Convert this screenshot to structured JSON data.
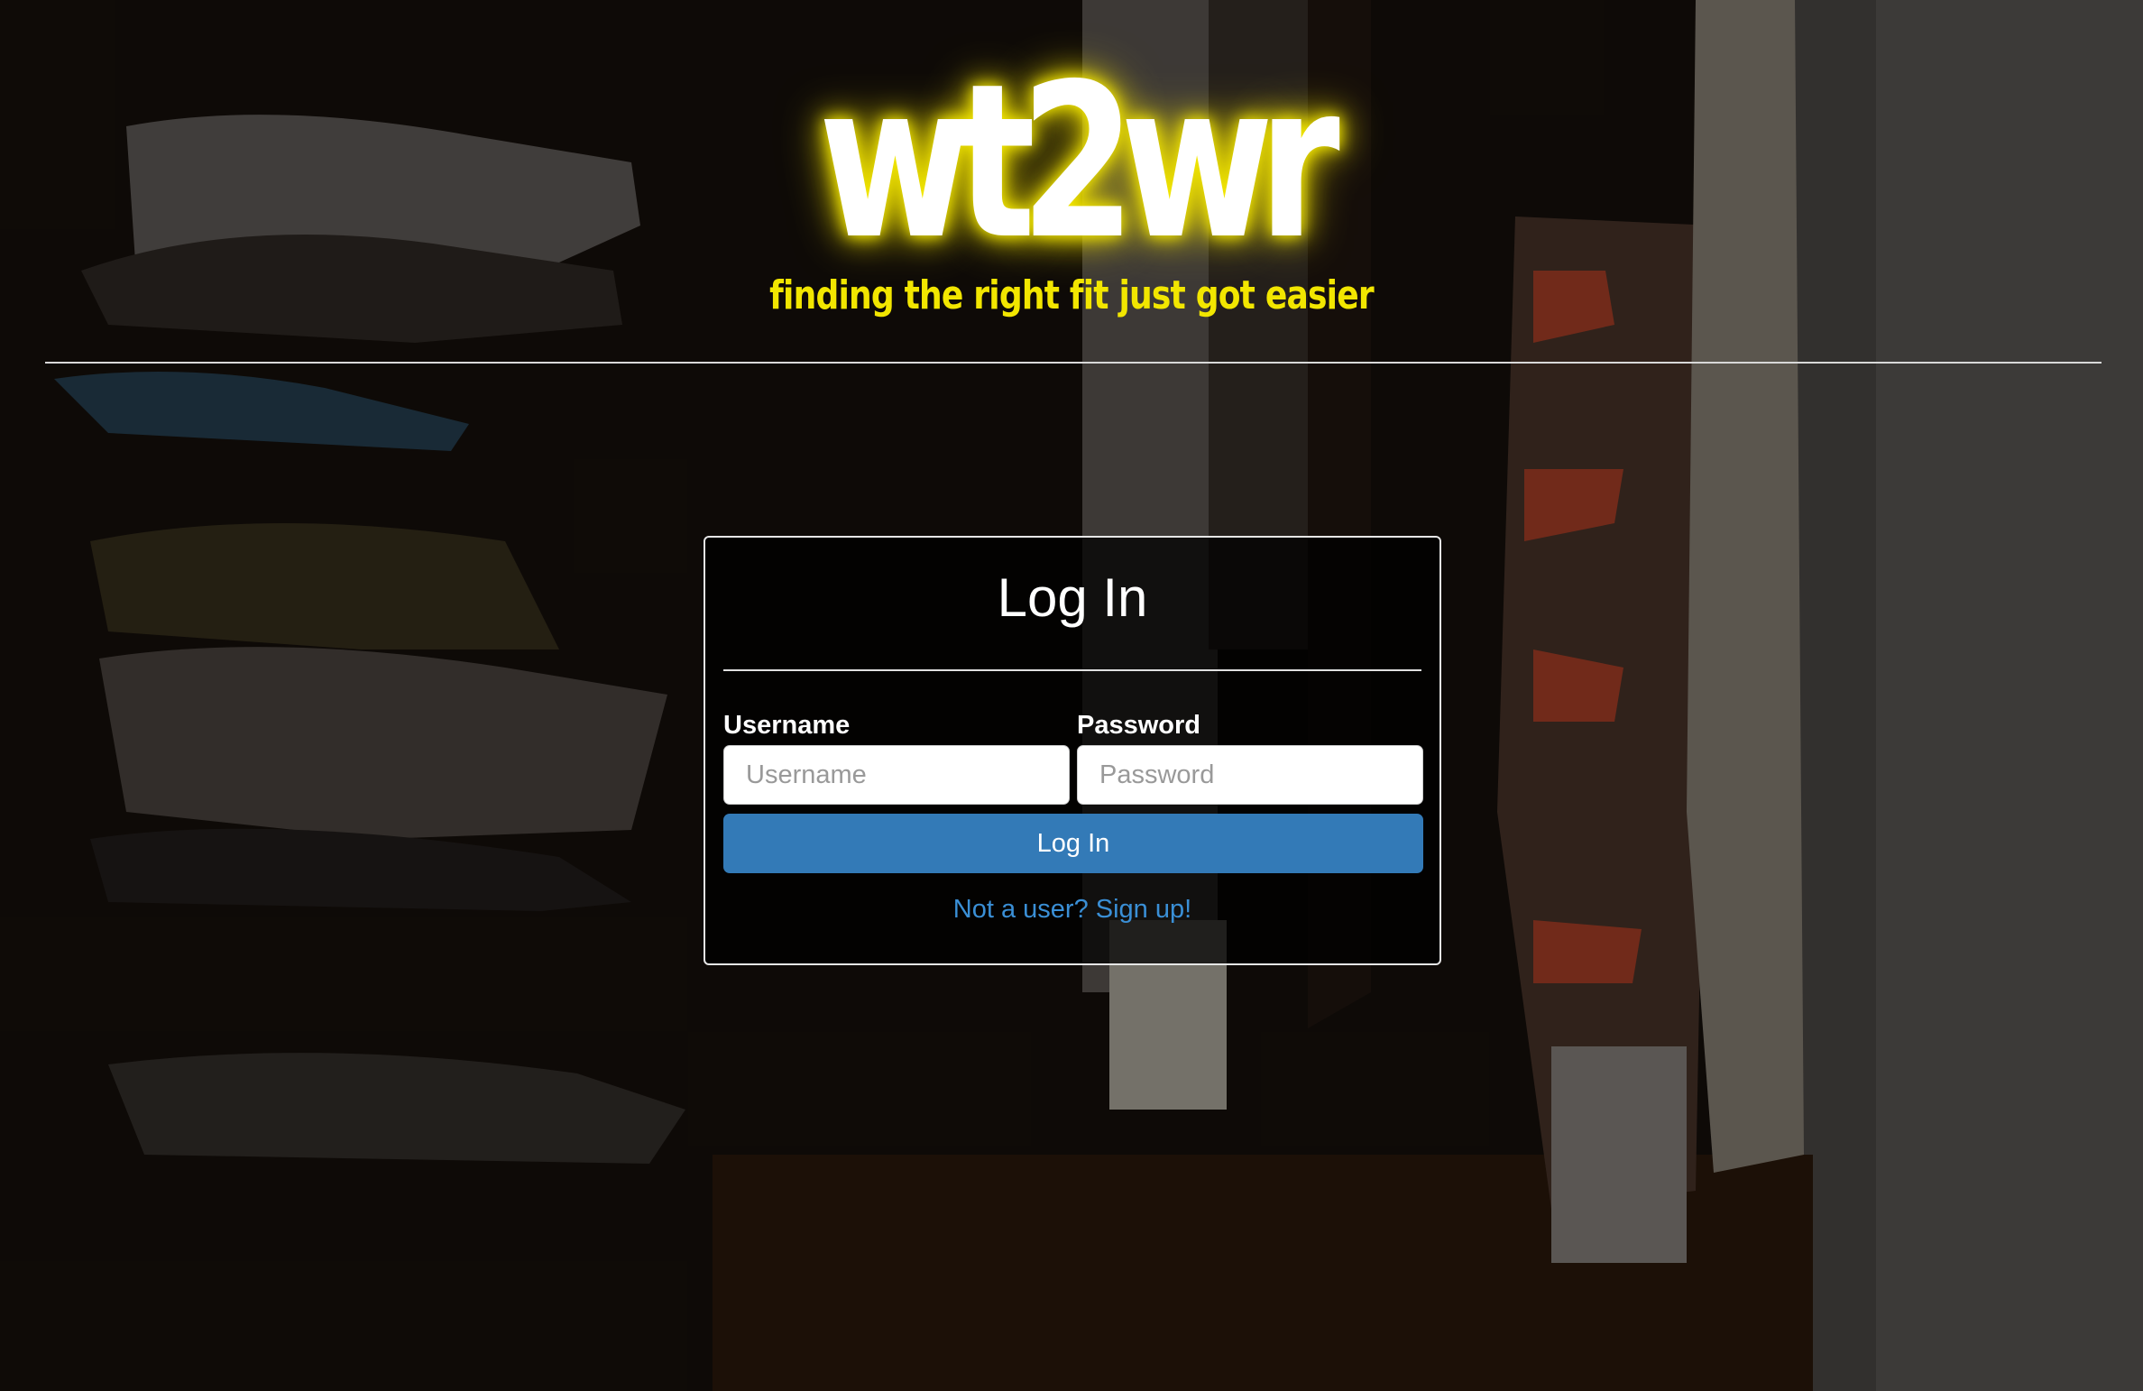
{
  "brand": {
    "title": "wt2wr",
    "tagline": "finding the right fit just got easier",
    "glow_color": "#f5ea00"
  },
  "login": {
    "heading": "Log In",
    "username_label": "Username",
    "username_placeholder": "Username",
    "username_value": "",
    "password_label": "Password",
    "password_placeholder": "Password",
    "password_value": "",
    "submit_label": "Log In",
    "signup_link": "Not a user? Sign up!",
    "button_color": "#337ab7",
    "link_color": "#3a8fd6"
  },
  "background": {
    "image_subject": "closet-with-clothes-photo"
  }
}
